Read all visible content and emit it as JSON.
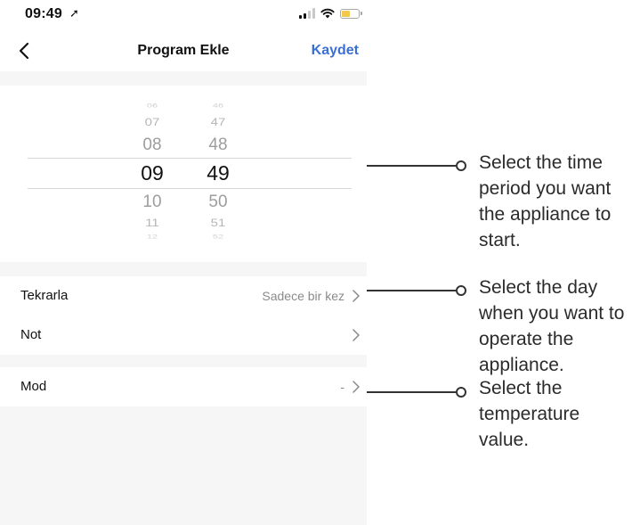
{
  "status_bar": {
    "time": "09:49",
    "location_glyph": "➚"
  },
  "nav": {
    "title": "Program Ekle",
    "save_label": "Kaydet"
  },
  "picker": {
    "hours": [
      "06",
      "07",
      "08",
      "09",
      "10",
      "11",
      "12"
    ],
    "minutes": [
      "46",
      "47",
      "48",
      "49",
      "50",
      "51",
      "52"
    ],
    "selected_hour": "09",
    "selected_minute": "49"
  },
  "rows": {
    "repeat": {
      "label": "Tekrarla",
      "value": "Sadece bir kez"
    },
    "note": {
      "label": "Not",
      "value": ""
    },
    "mode": {
      "label": "Mod",
      "value": "-"
    }
  },
  "callouts": {
    "time": "Select the time period you want the appliance to start.",
    "day": "Select the day when you want to operate the appliance.",
    "temperature": "Select the temperature value."
  },
  "colors": {
    "accent": "#3b6fd6",
    "section_bg": "#f6f6f6",
    "battery": "#f2c94c"
  }
}
